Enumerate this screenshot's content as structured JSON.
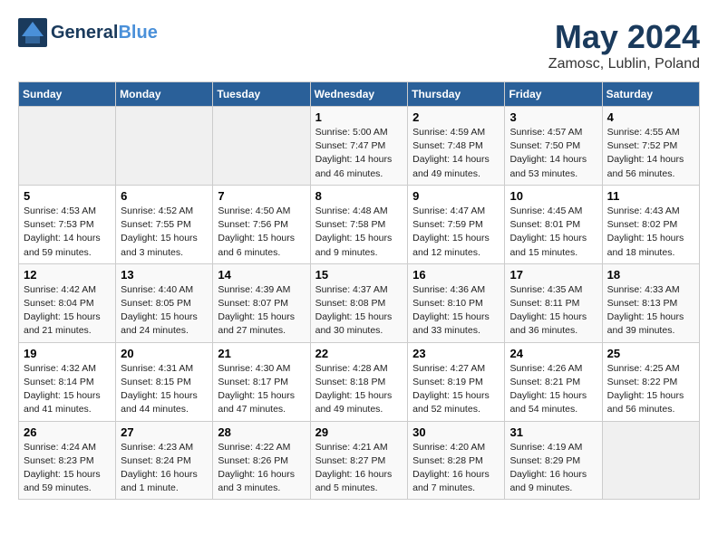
{
  "header": {
    "logo_line1": "General",
    "logo_line2": "Blue",
    "title": "May 2024",
    "subtitle": "Zamosc, Lublin, Poland"
  },
  "weekdays": [
    "Sunday",
    "Monday",
    "Tuesday",
    "Wednesday",
    "Thursday",
    "Friday",
    "Saturday"
  ],
  "weeks": [
    [
      {
        "day": "",
        "info": ""
      },
      {
        "day": "",
        "info": ""
      },
      {
        "day": "",
        "info": ""
      },
      {
        "day": "1",
        "info": "Sunrise: 5:00 AM\nSunset: 7:47 PM\nDaylight: 14 hours\nand 46 minutes."
      },
      {
        "day": "2",
        "info": "Sunrise: 4:59 AM\nSunset: 7:48 PM\nDaylight: 14 hours\nand 49 minutes."
      },
      {
        "day": "3",
        "info": "Sunrise: 4:57 AM\nSunset: 7:50 PM\nDaylight: 14 hours\nand 53 minutes."
      },
      {
        "day": "4",
        "info": "Sunrise: 4:55 AM\nSunset: 7:52 PM\nDaylight: 14 hours\nand 56 minutes."
      }
    ],
    [
      {
        "day": "5",
        "info": "Sunrise: 4:53 AM\nSunset: 7:53 PM\nDaylight: 14 hours\nand 59 minutes."
      },
      {
        "day": "6",
        "info": "Sunrise: 4:52 AM\nSunset: 7:55 PM\nDaylight: 15 hours\nand 3 minutes."
      },
      {
        "day": "7",
        "info": "Sunrise: 4:50 AM\nSunset: 7:56 PM\nDaylight: 15 hours\nand 6 minutes."
      },
      {
        "day": "8",
        "info": "Sunrise: 4:48 AM\nSunset: 7:58 PM\nDaylight: 15 hours\nand 9 minutes."
      },
      {
        "day": "9",
        "info": "Sunrise: 4:47 AM\nSunset: 7:59 PM\nDaylight: 15 hours\nand 12 minutes."
      },
      {
        "day": "10",
        "info": "Sunrise: 4:45 AM\nSunset: 8:01 PM\nDaylight: 15 hours\nand 15 minutes."
      },
      {
        "day": "11",
        "info": "Sunrise: 4:43 AM\nSunset: 8:02 PM\nDaylight: 15 hours\nand 18 minutes."
      }
    ],
    [
      {
        "day": "12",
        "info": "Sunrise: 4:42 AM\nSunset: 8:04 PM\nDaylight: 15 hours\nand 21 minutes."
      },
      {
        "day": "13",
        "info": "Sunrise: 4:40 AM\nSunset: 8:05 PM\nDaylight: 15 hours\nand 24 minutes."
      },
      {
        "day": "14",
        "info": "Sunrise: 4:39 AM\nSunset: 8:07 PM\nDaylight: 15 hours\nand 27 minutes."
      },
      {
        "day": "15",
        "info": "Sunrise: 4:37 AM\nSunset: 8:08 PM\nDaylight: 15 hours\nand 30 minutes."
      },
      {
        "day": "16",
        "info": "Sunrise: 4:36 AM\nSunset: 8:10 PM\nDaylight: 15 hours\nand 33 minutes."
      },
      {
        "day": "17",
        "info": "Sunrise: 4:35 AM\nSunset: 8:11 PM\nDaylight: 15 hours\nand 36 minutes."
      },
      {
        "day": "18",
        "info": "Sunrise: 4:33 AM\nSunset: 8:13 PM\nDaylight: 15 hours\nand 39 minutes."
      }
    ],
    [
      {
        "day": "19",
        "info": "Sunrise: 4:32 AM\nSunset: 8:14 PM\nDaylight: 15 hours\nand 41 minutes."
      },
      {
        "day": "20",
        "info": "Sunrise: 4:31 AM\nSunset: 8:15 PM\nDaylight: 15 hours\nand 44 minutes."
      },
      {
        "day": "21",
        "info": "Sunrise: 4:30 AM\nSunset: 8:17 PM\nDaylight: 15 hours\nand 47 minutes."
      },
      {
        "day": "22",
        "info": "Sunrise: 4:28 AM\nSunset: 8:18 PM\nDaylight: 15 hours\nand 49 minutes."
      },
      {
        "day": "23",
        "info": "Sunrise: 4:27 AM\nSunset: 8:19 PM\nDaylight: 15 hours\nand 52 minutes."
      },
      {
        "day": "24",
        "info": "Sunrise: 4:26 AM\nSunset: 8:21 PM\nDaylight: 15 hours\nand 54 minutes."
      },
      {
        "day": "25",
        "info": "Sunrise: 4:25 AM\nSunset: 8:22 PM\nDaylight: 15 hours\nand 56 minutes."
      }
    ],
    [
      {
        "day": "26",
        "info": "Sunrise: 4:24 AM\nSunset: 8:23 PM\nDaylight: 15 hours\nand 59 minutes."
      },
      {
        "day": "27",
        "info": "Sunrise: 4:23 AM\nSunset: 8:24 PM\nDaylight: 16 hours\nand 1 minute."
      },
      {
        "day": "28",
        "info": "Sunrise: 4:22 AM\nSunset: 8:26 PM\nDaylight: 16 hours\nand 3 minutes."
      },
      {
        "day": "29",
        "info": "Sunrise: 4:21 AM\nSunset: 8:27 PM\nDaylight: 16 hours\nand 5 minutes."
      },
      {
        "day": "30",
        "info": "Sunrise: 4:20 AM\nSunset: 8:28 PM\nDaylight: 16 hours\nand 7 minutes."
      },
      {
        "day": "31",
        "info": "Sunrise: 4:19 AM\nSunset: 8:29 PM\nDaylight: 16 hours\nand 9 minutes."
      },
      {
        "day": "",
        "info": ""
      }
    ]
  ]
}
